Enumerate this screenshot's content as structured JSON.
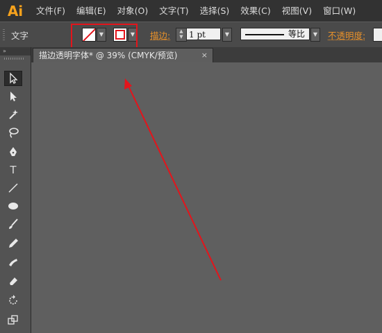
{
  "app": {
    "logo": "Ai"
  },
  "menu": [
    "文件(F)",
    "编辑(E)",
    "对象(O)",
    "文字(T)",
    "选择(S)",
    "效果(C)",
    "视图(V)",
    "窗口(W)"
  ],
  "control": {
    "tool_label": "文字",
    "stroke_label": "描边:",
    "stroke_weight": "1 pt",
    "profile_label": "等比",
    "opacity_label": "不透明度:"
  },
  "document": {
    "tab_title": "描边透明字体* @ 39% (CMYK/预览)",
    "close": "×"
  },
  "toolbox": {
    "collapse": "»",
    "tools": [
      "selection-tool",
      "direct-selection-tool",
      "magic-wand-tool",
      "lasso-tool",
      "pen-tool",
      "type-tool",
      "line-tool",
      "ellipse-tool",
      "paintbrush-tool",
      "pencil-tool",
      "blob-brush-tool",
      "eraser-tool",
      "rotate-tool",
      "scale-tool"
    ],
    "type_glyph": "T"
  },
  "colors": {
    "accent": "#e4141b",
    "logo": "#f7a21c",
    "label_orange": "#e8912a"
  }
}
